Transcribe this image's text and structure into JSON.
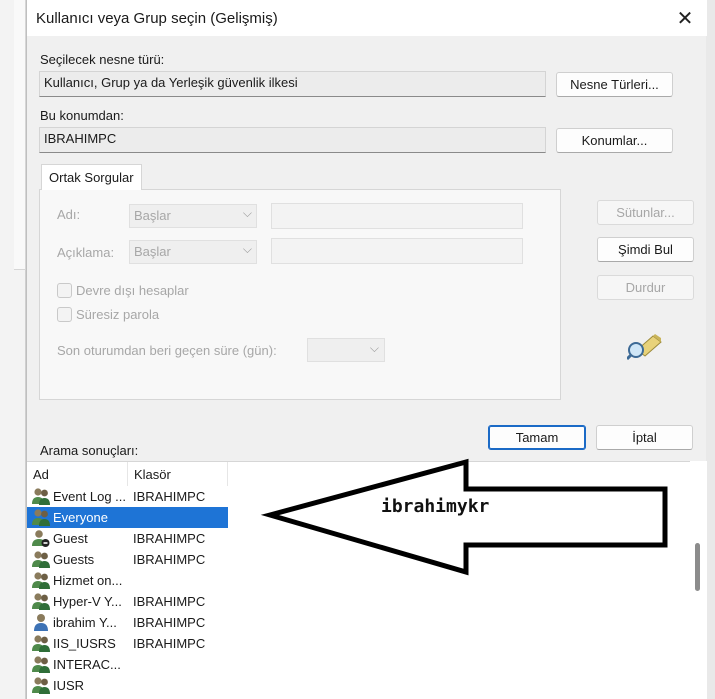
{
  "dialog": {
    "title": "Kullanıcı veya Grup seçin (Gelişmiş)"
  },
  "object_type": {
    "label": "Seçilecek nesne türü:",
    "value": "Kullanıcı, Grup ya da Yerleşik güvenlik ilkesi",
    "button": "Nesne Türleri..."
  },
  "location": {
    "label": "Bu konumdan:",
    "value": "IBRAHIMPC",
    "button": "Konumlar..."
  },
  "common_queries": {
    "tab": "Ortak Sorgular",
    "name_label": "Adı:",
    "name_mode": "Başlar",
    "desc_label": "Açıklama:",
    "desc_mode": "Başlar",
    "disabled_accounts": "Devre dışı hesaplar",
    "non_expiring_password": "Süresiz parola",
    "days_since_logon": "Son oturumdan beri geçen süre (gün):"
  },
  "side_buttons": {
    "columns": "Sütunlar...",
    "find_now": "Şimdi Bul",
    "stop": "Durdur"
  },
  "footer": {
    "ok": "Tamam",
    "cancel": "İptal"
  },
  "results": {
    "label": "Arama sonuçları:",
    "columns": [
      "Ad",
      "Klasör"
    ],
    "rows": [
      {
        "name": "Event Log ...",
        "folder": "IBRAHIMPC",
        "icon": "group-icon"
      },
      {
        "name": "Everyone",
        "folder": "",
        "icon": "group-icon",
        "selected": true
      },
      {
        "name": "Guest",
        "folder": "IBRAHIMPC",
        "icon": "disabled-user-icon"
      },
      {
        "name": "Guests",
        "folder": "IBRAHIMPC",
        "icon": "group-icon"
      },
      {
        "name": "Hizmet on...",
        "folder": "",
        "icon": "group-icon"
      },
      {
        "name": "Hyper-V Y...",
        "folder": "IBRAHIMPC",
        "icon": "group-icon"
      },
      {
        "name": "ibrahim Y...",
        "folder": "IBRAHIMPC",
        "icon": "user-icon"
      },
      {
        "name": "IIS_IUSRS",
        "folder": "IBRAHIMPC",
        "icon": "group-icon"
      },
      {
        "name": "INTERAC...",
        "folder": "",
        "icon": "group-icon"
      },
      {
        "name": "IUSR",
        "folder": "",
        "icon": "group-icon"
      }
    ]
  },
  "annotation": {
    "text": "ibrahimykr",
    "color": "#000000"
  },
  "colors": {
    "selection": "#1e74d6",
    "accent": "#1b6ac6"
  }
}
